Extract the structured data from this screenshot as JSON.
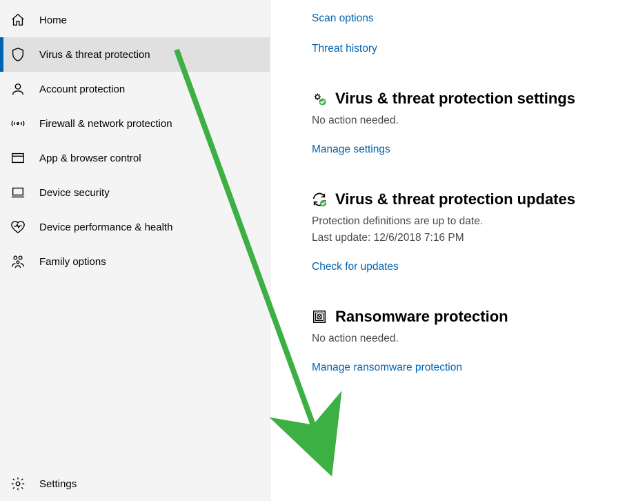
{
  "sidebar": {
    "items": [
      {
        "label": "Home"
      },
      {
        "label": "Virus & threat protection"
      },
      {
        "label": "Account protection"
      },
      {
        "label": "Firewall & network protection"
      },
      {
        "label": "App & browser control"
      },
      {
        "label": "Device security"
      },
      {
        "label": "Device performance & health"
      },
      {
        "label": "Family options"
      }
    ],
    "settings_label": "Settings"
  },
  "content": {
    "scan_options": "Scan options",
    "threat_history": "Threat history",
    "sec_settings": {
      "title": "Virus & threat protection settings",
      "status": "No action needed.",
      "link": "Manage settings"
    },
    "sec_updates": {
      "title": "Virus & threat protection updates",
      "status": "Protection definitions are up to date.",
      "last_update": "Last update: 12/6/2018 7:16 PM",
      "link": "Check for updates"
    },
    "sec_ransom": {
      "title": "Ransomware protection",
      "status": "No action needed.",
      "link": "Manage ransomware protection"
    }
  }
}
